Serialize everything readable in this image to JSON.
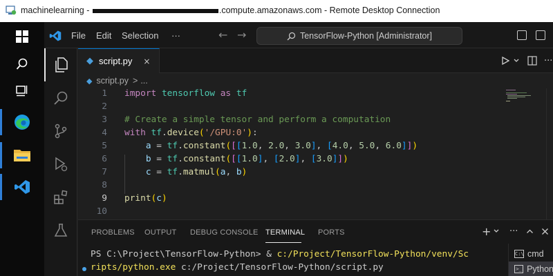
{
  "rdp": {
    "title_prefix": "machinelearning - ",
    "title_suffix": ".compute.amazonaws.com - Remote Desktop Connection"
  },
  "taskbar": {
    "items": [
      "windows-start",
      "search",
      "task-view",
      "edge",
      "file-explorer",
      "vscode"
    ]
  },
  "vscode": {
    "menu": [
      "File",
      "Edit",
      "Selection",
      "···"
    ],
    "command_center": "TensorFlow-Python [Administrator]",
    "tab": {
      "label": "script.py",
      "close": "×"
    },
    "breadcrumb": {
      "file": "script.py",
      "separator": ">",
      "more": "..."
    },
    "code_lines": [
      "import tensorflow as tf",
      "",
      "# Create a simple tensor and perform a computation",
      "with tf.device('/GPU:0'):",
      "    a = tf.constant([[1.0, 2.0, 3.0], [4.0, 5.0, 6.0]])",
      "    b = tf.constant([[1.0], [2.0], [3.0]])",
      "    c = tf.matmul(a, b)",
      "",
      "print(c)",
      ""
    ],
    "line_numbers": [
      "1",
      "2",
      "3",
      "4",
      "5",
      "6",
      "7",
      "8",
      "9",
      "10"
    ],
    "active_line": 9,
    "panel": {
      "tabs": [
        "PROBLEMS",
        "OUTPUT",
        "DEBUG CONSOLE",
        "TERMINAL",
        "PORTS"
      ],
      "active_tab": "TERMINAL",
      "terminal_prompt": "PS C:\\Project\\TensorFlow-Python> & ",
      "terminal_cmd_1": "c:/Project/TensorFlow-Python/venv/Sc",
      "terminal_cmd_2": "ripts/python.exe",
      "terminal_cmd_3": " c:/Project/TensorFlow-Python/script.py",
      "terminal_list": [
        "cmd",
        "Python"
      ],
      "active_terminal": "Python"
    }
  },
  "colors": {
    "accent": "#0078d4",
    "keyword": "#c586c0",
    "string": "#ce9178",
    "comment": "#6a9955",
    "number": "#b5cea8"
  }
}
